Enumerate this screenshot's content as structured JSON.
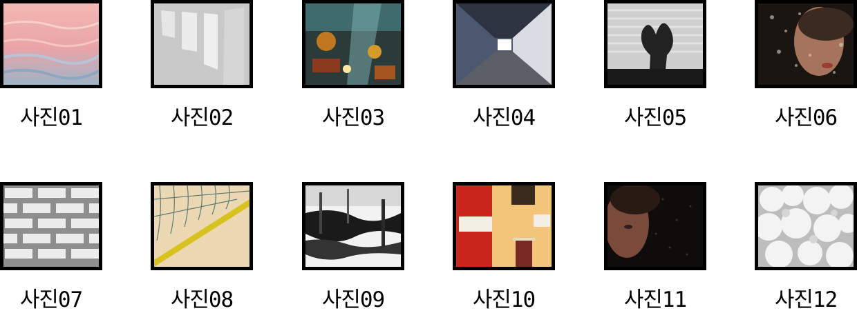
{
  "gallery": {
    "items": [
      {
        "label": "사진01",
        "image": "pink-water-ripples"
      },
      {
        "label": "사진02",
        "image": "window-light-on-wall"
      },
      {
        "label": "사진03",
        "image": "pinball-machine"
      },
      {
        "label": "사진04",
        "image": "corridor-perspective"
      },
      {
        "label": "사진05",
        "image": "plant-shadow-on-blinds"
      },
      {
        "label": "사진06",
        "image": "face-behind-wet-glass"
      },
      {
        "label": "사진07",
        "image": "white-brick-pattern"
      },
      {
        "label": "사진08",
        "image": "volleyball-net-on-sand"
      },
      {
        "label": "사진09",
        "image": "black-white-paint-strokes"
      },
      {
        "label": "사진10",
        "image": "red-yellow-building-signs"
      },
      {
        "label": "사진11",
        "image": "face-in-dark-rain"
      },
      {
        "label": "사진12",
        "image": "white-clouds"
      }
    ]
  }
}
